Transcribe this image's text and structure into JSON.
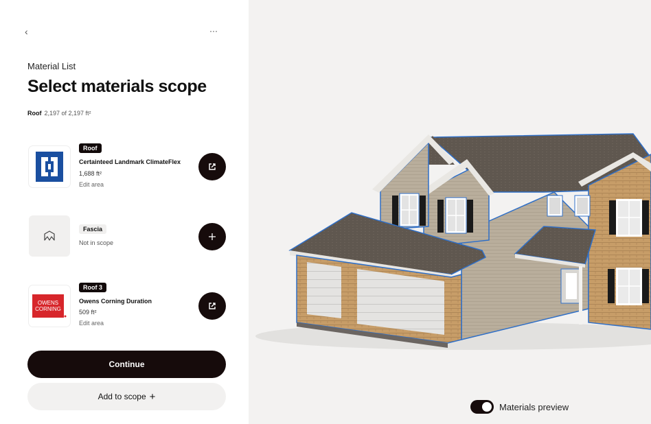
{
  "header": {
    "back_icon": "chevron-left-icon",
    "back_glyph": "‹",
    "more_icon": "more-horizontal-icon",
    "more_glyph": "···",
    "eyebrow": "Material List",
    "title": "Select materials scope"
  },
  "summary": {
    "label": "Roof",
    "value": "2,197 of 2,197 ft²"
  },
  "items": [
    {
      "badge": "Roof",
      "name": "Certainteed Landmark ClimateFlex",
      "area": "1,688 ft²",
      "link": "Edit area",
      "logo_icon": "certainteed-logo-icon",
      "action_icon": "edit-icon"
    },
    {
      "badge": "Fascia",
      "status": "Not in scope",
      "logo_icon": "fascia-icon",
      "action_icon": "plus-icon"
    },
    {
      "badge": "Roof 3",
      "name": "Owens Corning Duration",
      "area": "509 ft²",
      "link": "Edit area",
      "logo_icon": "owens-corning-logo-icon",
      "logo_text_line1": "OWENS",
      "logo_text_line2": "CORNING",
      "action_icon": "edit-icon"
    }
  ],
  "actions": {
    "continue_label": "Continue",
    "add_label": "Add to scope",
    "add_glyph": "+"
  },
  "viewer": {
    "toggle_label": "Materials preview",
    "toggle_on": true
  },
  "colors": {
    "primary": "#160b0b",
    "certainteed_blue": "#1a4fa0",
    "owens_red": "#d7262b",
    "roof": "#5f574f",
    "siding": "#b7ad9c",
    "brick": "#c49a66",
    "outline": "#2f6fc7"
  }
}
